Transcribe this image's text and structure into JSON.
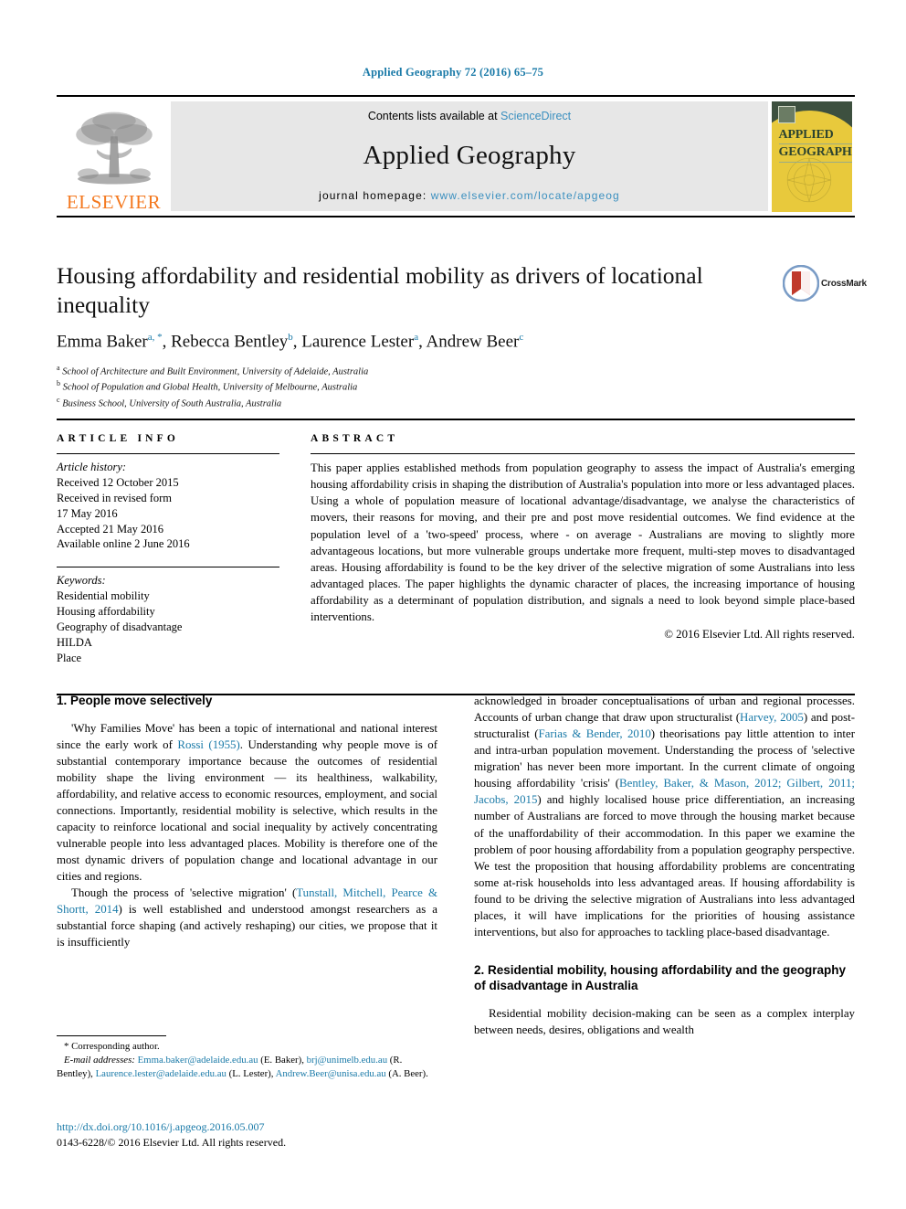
{
  "running_head": "Applied Geography 72 (2016) 65–75",
  "masthead": {
    "publisher_name": "ELSEVIER",
    "contents_line_prefix": "Contents lists available at ",
    "sciencedirect": "ScienceDirect",
    "journal_title": "Applied Geography",
    "homepage_label": "journal homepage: ",
    "homepage_url": "www.elsevier.com/locate/apgeog",
    "cover_title_line1": "APPLIED",
    "cover_title_line2": "GEOGRAPHY"
  },
  "article": {
    "title": "Housing affordability and residential mobility as drivers of locational inequality",
    "authors": [
      {
        "name": "Emma Baker",
        "marks": "a, *"
      },
      {
        "name": "Rebecca Bentley",
        "marks": "b"
      },
      {
        "name": "Laurence Lester",
        "marks": "a"
      },
      {
        "name": "Andrew Beer",
        "marks": "c"
      }
    ],
    "affiliations": [
      {
        "mark": "a",
        "text": "School of Architecture and Built Environment, University of Adelaide, Australia"
      },
      {
        "mark": "b",
        "text": "School of Population and Global Health, University of Melbourne, Australia"
      },
      {
        "mark": "c",
        "text": "Business School, University of South Australia, Australia"
      }
    ],
    "crossmark_label": "CrossMark"
  },
  "info": {
    "heading": "ARTICLE INFO",
    "history_label": "Article history:",
    "history": [
      "Received 12 October 2015",
      "Received in revised form",
      "17 May 2016",
      "Accepted 21 May 2016",
      "Available online 2 June 2016"
    ],
    "keywords_label": "Keywords:",
    "keywords": [
      "Residential mobility",
      "Housing affordability",
      "Geography of disadvantage",
      "HILDA",
      "Place"
    ]
  },
  "abstract": {
    "heading": "ABSTRACT",
    "text": "This paper applies established methods from population geography to assess the impact of Australia's emerging housing affordability crisis in shaping the distribution of Australia's population into more or less advantaged places. Using a whole of population measure of locational advantage/disadvantage, we analyse the characteristics of movers, their reasons for moving, and their pre and post move residential outcomes. We find evidence at the population level of a 'two-speed' process, where - on average - Australians are moving to slightly more advantageous locations, but more vulnerable groups undertake more frequent, multi-step moves to disadvantaged areas. Housing affordability is found to be the key driver of the selective migration of some Australians into less advantaged places. The paper highlights the dynamic character of places, the increasing importance of housing affordability as a determinant of population distribution, and signals a need to look beyond simple place-based interventions.",
    "copyright": "© 2016 Elsevier Ltd. All rights reserved."
  },
  "sections": {
    "sec1_heading": "1. People move selectively",
    "sec1_para1_a": "'Why Families Move' has been a topic of international and national interest since the early work of ",
    "sec1_para1_ref": "Rossi (1955)",
    "sec1_para1_b": ". Understanding why people move is of substantial contemporary importance because the outcomes of residential mobility shape the living environment — its healthiness, walkability, affordability, and relative access to economic resources, employment, and social connections. Importantly, residential mobility is selective, which results in the capacity to reinforce locational and social inequality by actively concentrating vulnerable people into less advantaged places. Mobility is therefore one of the most dynamic drivers of population change and locational advantage in our cities and regions.",
    "sec1_para2_a": "Though the process of 'selective migration' (",
    "sec1_para2_ref": "Tunstall, Mitchell, Pearce & Shortt, 2014",
    "sec1_para2_b": ") is well established and understood amongst researchers as a substantial force shaping (and actively reshaping) our cities, we propose that it is insufficiently",
    "sec1_para2_cont_a": "acknowledged in broader conceptualisations of urban and regional processes. Accounts of urban change that draw upon structuralist (",
    "sec1_para2_cont_ref1": "Harvey, 2005",
    "sec1_para2_cont_b": ") and post-structuralist (",
    "sec1_para2_cont_ref2": "Farias & Bender, 2010",
    "sec1_para2_cont_c": ") theorisations pay little attention to inter and intra-urban population movement. Understanding the process of 'selective migration' has never been more important. In the current climate of ongoing housing affordability 'crisis' (",
    "sec1_para2_cont_ref3": "Bentley, Baker, & Mason, 2012; Gilbert, 2011; Jacobs, 2015",
    "sec1_para2_cont_d": ") and highly localised house price differentiation, an increasing number of Australians are forced to move through the housing market because of the unaffordability of their accommodation. In this paper we examine the problem of poor housing affordability from a population geography perspective. We test the proposition that housing affordability problems are concentrating some at-risk households into less advantaged areas. If housing affordability is found to be driving the selective migration of Australians into less advantaged places, it will have implications for the priorities of housing assistance interventions, but also for approaches to tackling place-based disadvantage.",
    "sec2_heading": "2. Residential mobility, housing affordability and the geography of disadvantage in Australia",
    "sec2_para1": "Residential mobility decision-making can be seen as a complex interplay between needs, desires, obligations and wealth"
  },
  "footnote": {
    "corresponding": "* Corresponding author.",
    "email_label": "E-mail addresses:",
    "emails": [
      {
        "address": "Emma.baker@adelaide.edu.au",
        "person": " (E. Baker), "
      },
      {
        "address": "brj@unimelb.edu.au",
        "person": " (R. Bentley), "
      },
      {
        "address": "Laurence.lester@adelaide.edu.au",
        "person": " (L. Lester), "
      },
      {
        "address": "Andrew.Beer@unisa.edu.au",
        "person": " (A. Beer)."
      }
    ],
    "doi": "http://dx.doi.org/10.1016/j.apgeog.2016.05.007",
    "issn_line": "0143-6228/© 2016 Elsevier Ltd. All rights reserved."
  },
  "colors": {
    "link": "#1a7aa8",
    "elsevier_orange": "#F47920",
    "banner_bg": "#e7e7e7",
    "cover_green": "#3d503f",
    "cover_yellow": "#e8c93c"
  }
}
